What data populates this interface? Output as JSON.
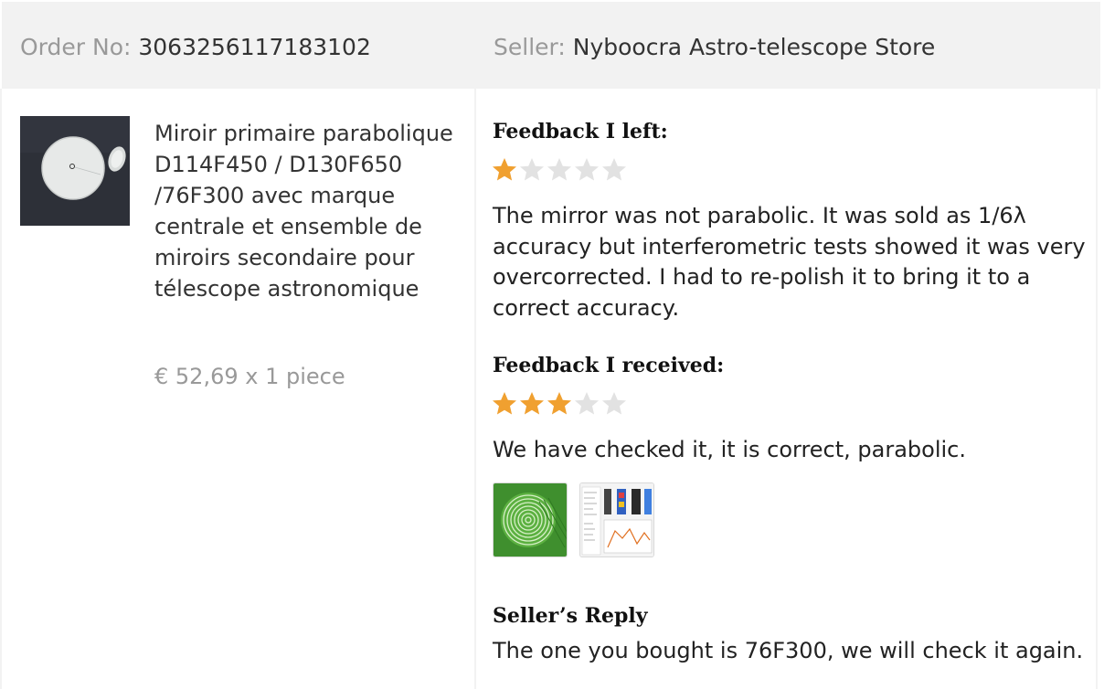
{
  "order": {
    "label": "Order No:",
    "number": "3063256117183102"
  },
  "seller": {
    "label": "Seller:",
    "name": "Nyboocra Astro-telescope Store"
  },
  "product": {
    "title": "Miroir primaire parabolique D114F450 / D130F650 /76F300 avec marque centrale et ensemble de miroirs secondaire pour télescope astronomique",
    "price": "€ 52,69 x 1 piece",
    "thumbnail_icon": "mirror-photo"
  },
  "feedback_left": {
    "title": "Feedback I left:",
    "rating": 1,
    "max_rating": 5,
    "text": "The mirror was not parabolic. It was sold as 1/6λ accuracy but interferometric tests showed it was very overcorrected. I had to re-polish it to bring it to a correct accuracy."
  },
  "feedback_received": {
    "title": "Feedback I received:",
    "rating": 3,
    "max_rating": 5,
    "text": "We have checked it, it is correct, parabolic.",
    "attachments": [
      {
        "icon": "interferogram-photo"
      },
      {
        "icon": "analysis-screenshot"
      }
    ]
  },
  "seller_reply": {
    "title": "Seller’s Reply",
    "text": "The one you bought is 76F300, we will check it again."
  },
  "colors": {
    "star_filled": "#f0a030",
    "star_empty": "#e2e2e2",
    "header_bg": "#f2f2f2",
    "label_gray": "#999999"
  }
}
